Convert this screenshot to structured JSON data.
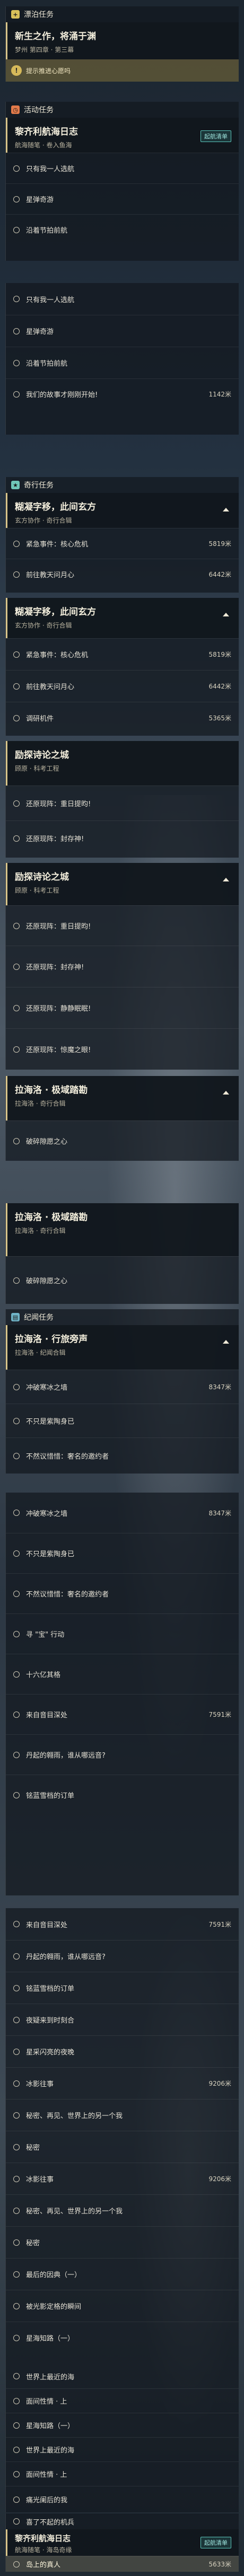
{
  "sections": {
    "daily": {
      "label": "漂泊任务",
      "icon": "plus-icon",
      "color": "#d8c05a"
    },
    "event": {
      "label": "活动任务",
      "icon": "clock-icon",
      "color": "#e27a4a"
    },
    "adventure": {
      "label": "奇行任务",
      "icon": "star-icon",
      "color": "#6fc7b8"
    },
    "codex": {
      "label": "纪闻任务",
      "icon": "book-icon",
      "color": "#6fb4c7"
    }
  },
  "cards": {
    "c1": {
      "title": "新生之作，将涌于渊",
      "sub": "梦州 第四章 · 第三幕"
    },
    "tip": {
      "label": "提示推进心愿吗"
    },
    "c2": {
      "title": "黎齐利航海日志",
      "sub": "航海随笔 · 卷入鱼海",
      "badge": "起航清单"
    },
    "c3": {
      "title": "糊凝字移，此间玄方",
      "sub": "玄方协作 · 奇行合辑"
    },
    "c4": {
      "title": "糊凝字移，此间玄方",
      "sub": "玄方协作 · 奇行合辑"
    },
    "c5": {
      "title": "励探诗论之城",
      "sub": "顾原 · 科考工程"
    },
    "c6": {
      "title": "励探诗论之城",
      "sub": "顾原 · 科考工程"
    },
    "c7": {
      "title": "拉海洛 · 极域踏勘",
      "sub": "拉海洛 · 奇行合辑"
    },
    "c8": {
      "title": "拉海洛 · 极域踏勘",
      "sub": "拉海洛 · 奇行合辑"
    },
    "c9": {
      "title": "拉海洛 · 行旅旁声",
      "sub": "拉海洛 · 纪闻合辑"
    },
    "c10": {
      "title": "黎齐利航海日志",
      "sub": "航海随笔 · 海岛奇缘",
      "badge": "起航清单"
    }
  },
  "rows": {
    "r1": {
      "label": "只有我一人选航"
    },
    "r2": {
      "label": "星弹奇游"
    },
    "r3": {
      "label": "沿着节拍前航"
    },
    "r4": {
      "label": "只有我一人选航"
    },
    "r5": {
      "label": "星弹奇游"
    },
    "r6": {
      "label": "沿着节拍前航"
    },
    "r7": {
      "label": "我们的故事才刚刚开始!",
      "dist": "1142米"
    },
    "r8": {
      "label": "紧急事件：核心危机",
      "dist": "5819米"
    },
    "r9": {
      "label": "前往教天问月心",
      "dist": "6442米"
    },
    "r10": {
      "label": "紧急事件：核心危机",
      "dist": "5819米"
    },
    "r11": {
      "label": "前往教天问月心",
      "dist": "6442米"
    },
    "r12": {
      "label": "调研机件",
      "dist": "5365米"
    },
    "r13": {
      "label": "还原现阵：重日提昀!"
    },
    "r14": {
      "label": "还原现阵：封存神!"
    },
    "r15": {
      "label": "还原现阵：重日提昀!"
    },
    "r16": {
      "label": "还原现阵：封存神!"
    },
    "r17": {
      "label": "还原现阵：静静眠眠!"
    },
    "r18": {
      "label": "还原现阵：惊魔之眼!"
    },
    "r19": {
      "label": "破碎隙愿之心"
    },
    "r20": {
      "label": "破碎隙愿之心"
    },
    "r21": {
      "label": "冲破寒冰之墙",
      "dist": "8347米"
    },
    "r22": {
      "label": "不只是紫陶身已"
    },
    "r23": {
      "label": "不然议惜惜：奢名的邀约者"
    },
    "r24": {
      "label": "冲破寒冰之墙",
      "dist": "8347米"
    },
    "r25": {
      "label": "不只是紫陶身已"
    },
    "r26": {
      "label": "不然议惜惜：奢名的邀约者"
    },
    "r27": {
      "label": "寻 \"宝\" 行动"
    },
    "r28": {
      "label": "十六亿其格"
    },
    "r29": {
      "label": "来自音目深处",
      "dist": "7591米"
    },
    "r30": {
      "label": "丹起的翱雨，谁从哪远音?"
    },
    "r31": {
      "label": "铭蓝雪档的订单"
    },
    "r32": {
      "label": "来自音目深处",
      "dist": "7591米"
    },
    "r33": {
      "label": "丹起的翱雨，谁从哪远音?"
    },
    "r34": {
      "label": "铭蓝雪档的订单"
    },
    "r35": {
      "label": "夜疑来到时刻合"
    },
    "r36": {
      "label": "星采闪亮的夜晚"
    },
    "r37": {
      "label": "冰影往事",
      "dist": "9206米"
    },
    "r38": {
      "label": "秘密、再见、世界上的另一个我"
    },
    "r39": {
      "label": "秘密"
    },
    "r40": {
      "label": "冰影往事",
      "dist": "9206米"
    },
    "r41": {
      "label": "秘密、再见、世界上的另一个我"
    },
    "r42": {
      "label": "秘密"
    },
    "r43": {
      "label": "最后的因典（一）"
    },
    "r44": {
      "label": "被光影定格的瞬间"
    },
    "r45": {
      "label": "星海知路（一）"
    },
    "r46": {
      "label": "世界上最近的海"
    },
    "r47": {
      "label": "面间性情 · 上"
    },
    "r48": {
      "label": "星海知路（一）"
    },
    "r49": {
      "label": "世界上最近的海"
    },
    "r50": {
      "label": "面间性情 · 上"
    },
    "r51": {
      "label": "痛光阑后的我"
    },
    "r52": {
      "label": "喜了不起的机兵"
    },
    "r53": {
      "label": "岛上的真人",
      "dist": "5633米"
    }
  }
}
